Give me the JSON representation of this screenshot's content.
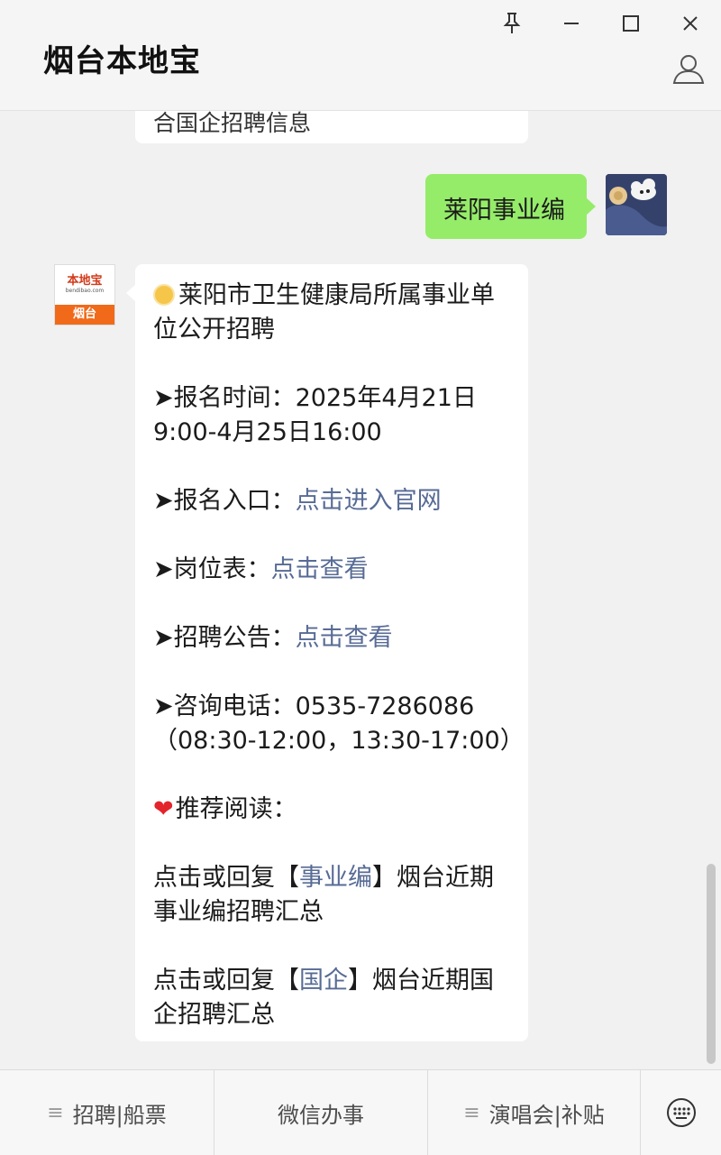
{
  "window": {
    "title": "烟台本地宝"
  },
  "chat": {
    "previous_message_partial": "合国企招聘信息",
    "user_message": "莱阳事业编",
    "bot_message": {
      "line1": "莱阳市卫生健康局所属事业单位公开招聘",
      "reg_time_label": "➤报名时间：",
      "reg_time_value": "2025年4月21日9:00-4月25日16:00",
      "reg_entry_label": "➤报名入口：",
      "reg_entry_link": "点击进入官网",
      "positions_label": "➤岗位表：",
      "positions_link": "点击查看",
      "notice_label": "➤招聘公告：",
      "notice_link": "点击查看",
      "phone_label": "➤咨询电话：",
      "phone_value": "0535-7286086",
      "phone_hours": "（08:30-12:00，13:30-17:00）",
      "recommend": "推荐阅读：",
      "rec1_prefix": "点击或回复【",
      "rec1_link": "事业编",
      "rec1_suffix": "】烟台近期事业编招聘汇总",
      "rec2_prefix": "点击或回复【",
      "rec2_link": "国企",
      "rec2_suffix": "】烟台近期国企招聘汇总"
    },
    "bot_avatar": {
      "brand": "本地宝",
      "url": "bendibao.com",
      "city": "烟台"
    }
  },
  "menu": {
    "item1": "招聘|船票",
    "item2": "微信办事",
    "item3": "演唱会|补贴"
  },
  "colors": {
    "user_bubble": "#95ec69",
    "link": "#576b95",
    "background": "#f1f1f1",
    "avatar_orange": "#f06a1a"
  }
}
